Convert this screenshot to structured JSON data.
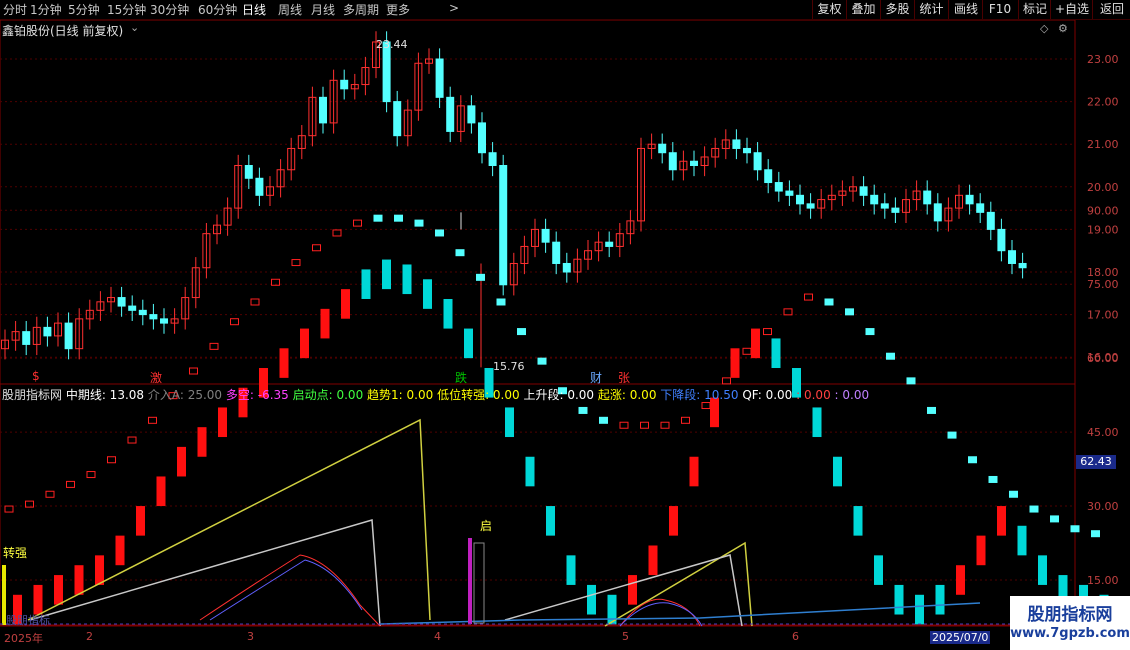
{
  "toolbar": {
    "timeframes": [
      "分时",
      "1分钟",
      "5分钟",
      "15分钟",
      "30分钟",
      "60分钟",
      "日线",
      "周线",
      "月线",
      "多周期",
      "更多"
    ],
    "active_timeframe": "日线",
    "right_buttons": [
      "复权",
      "叠加",
      "多股",
      "统计",
      "画线",
      "F10",
      "+自选",
      "返回"
    ],
    "tag_button": "标记"
  },
  "main_chart": {
    "title": "鑫铂股份(日线 前复权)",
    "high_label": "23.44",
    "low_label": "15.76",
    "markers": [
      {
        "text": "$",
        "color": "#ff3030"
      },
      {
        "text": "激",
        "color": "#ff3030"
      },
      {
        "text": "跌",
        "color": "#00c000"
      },
      {
        "text": "财",
        "color": "#6aa8ff"
      },
      {
        "text": "张",
        "color": "#ff3030"
      }
    ],
    "y_ticks": [
      "23.00",
      "22.00",
      "21.00",
      "20.00",
      "19.00",
      "18.00",
      "17.00",
      "16.00"
    ]
  },
  "indicator": {
    "name": "股朋指标网",
    "items": [
      {
        "label": "中期线:",
        "value": "13.08",
        "color": "#ffffff"
      },
      {
        "label": "介入A:",
        "value": "25.00",
        "color": "#808080"
      },
      {
        "label": "多空:",
        "value": "-6.35",
        "color": "#ff40ff"
      },
      {
        "label": "启动点:",
        "value": "0.00",
        "color": "#40ff40"
      },
      {
        "label": "趋势1:",
        "value": "0.00",
        "color": "#ffff00"
      },
      {
        "label": "低位转强:",
        "value": "0.00",
        "color": "#ffff00"
      },
      {
        "label": "上升段:",
        "value": "0.00",
        "color": "#ffffff"
      },
      {
        "label": "起涨:",
        "value": "0.00",
        "color": "#ffff00"
      },
      {
        "label": "下降段:",
        "value": "10.50",
        "color": "#4080ff"
      },
      {
        "label": "QF:",
        "value": "0.00",
        "color": "#ffffff"
      },
      {
        "label": ":",
        "value": "0.00",
        "color": "#ff4040"
      },
      {
        "label": ":",
        "value": "0.00",
        "color": "#c080ff"
      }
    ],
    "y_ticks": [
      "90.00",
      "75.00",
      "60.00",
      "45.00",
      "30.00",
      "15.00"
    ],
    "current_value": "62.43",
    "label_zhuanqiang": "转强",
    "label_qi": "启",
    "bottom_text": "股朋指标"
  },
  "date_axis": {
    "labels": [
      "2025年",
      "2",
      "3",
      "4",
      "5",
      "6"
    ],
    "current": "2025/07/0"
  },
  "watermark": {
    "line1": "股朋指标网",
    "line2": "www.7gpzb.com"
  }
}
